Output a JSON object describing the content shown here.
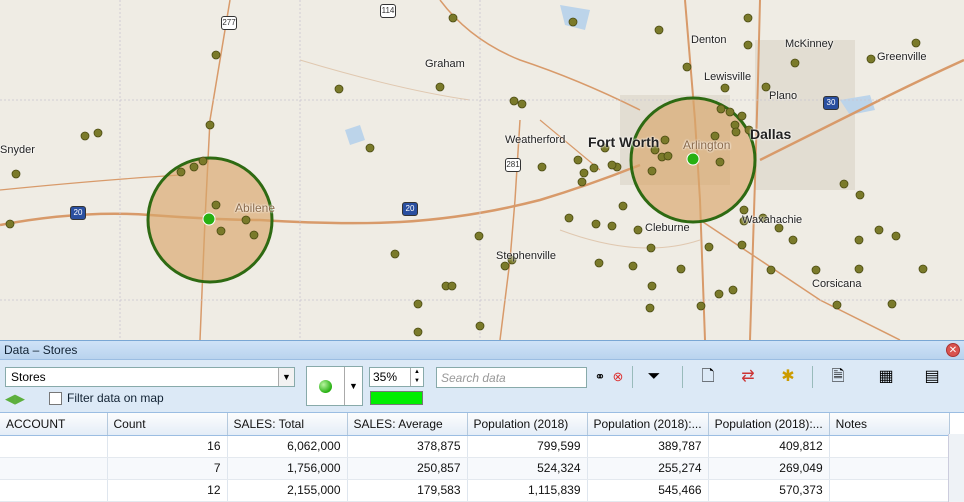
{
  "map": {
    "cities": [
      {
        "name": "Denton",
        "cls": ""
      },
      {
        "name": "McKinney",
        "cls": ""
      },
      {
        "name": "Greenville",
        "cls": ""
      },
      {
        "name": "Graham",
        "cls": ""
      },
      {
        "name": "Lewisville",
        "cls": ""
      },
      {
        "name": "Plano",
        "cls": ""
      },
      {
        "name": "Snyder",
        "cls": ""
      },
      {
        "name": "Weatherford",
        "cls": ""
      },
      {
        "name": "Fort Worth",
        "cls": "big"
      },
      {
        "name": "Dallas",
        "cls": "big"
      },
      {
        "name": "Arlington",
        "cls": "in-radius"
      },
      {
        "name": "Abilene",
        "cls": "in-radius"
      },
      {
        "name": "Cleburne",
        "cls": ""
      },
      {
        "name": "Waxahachie",
        "cls": ""
      },
      {
        "name": "Stephenville",
        "cls": ""
      },
      {
        "name": "Corsicana",
        "cls": ""
      }
    ],
    "shields": [
      "277",
      "114",
      "281",
      "20",
      "20",
      "30"
    ],
    "radius_color": "#d9a66a",
    "radius_stroke": "#2e6a12",
    "store_color": "#7a7a2a",
    "center_color": "#27b012"
  },
  "panel": {
    "title": "Data – Stores",
    "close_icon": "✕",
    "layer": "Stores",
    "filter_label": "Filter data on map",
    "opacity": "35%",
    "opacity_color": "#00ee00",
    "search_placeholder": "Search data"
  },
  "table": {
    "columns": [
      "ACCOUNT",
      "Count",
      "SALES: Total",
      "SALES: Average",
      "Population (2018)",
      "Population (2018):...",
      "Population (2018):...",
      "Notes"
    ],
    "rows": [
      [
        "",
        "16",
        "6,062,000",
        "378,875",
        "799,599",
        "389,787",
        "409,812",
        ""
      ],
      [
        "",
        "7",
        "1,756,000",
        "250,857",
        "524,324",
        "255,274",
        "269,049",
        ""
      ],
      [
        "",
        "12",
        "2,155,000",
        "179,583",
        "1,115,839",
        "545,466",
        "570,373",
        ""
      ]
    ]
  }
}
